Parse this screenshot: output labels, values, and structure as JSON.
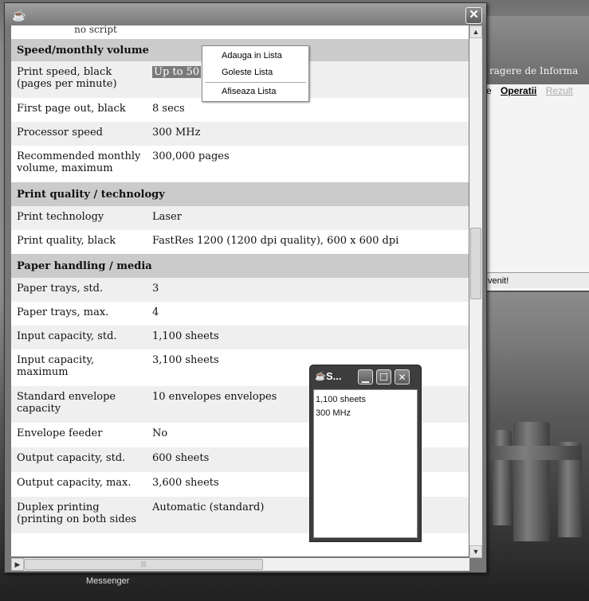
{
  "main_window": {
    "close_label": "✕",
    "noscript_text": "no script",
    "context_menu": {
      "items": [
        "Adauga in Lista",
        "Goleste Lista",
        "Afiseaza Lista"
      ]
    },
    "sections": [
      {
        "title": "Speed/monthly volume"
      },
      {
        "title": "Print quality / technology"
      },
      {
        "title": "Paper handling / media"
      }
    ],
    "rows": {
      "print_speed": {
        "label": "Print speed, black",
        "label2": "(pages per minute)",
        "value": "Up to 50"
      },
      "first_page": {
        "label": "First page out, black",
        "value": "8 secs"
      },
      "processor": {
        "label": "Processor speed",
        "value": "300 MHz"
      },
      "monthly": {
        "label": "Recommended monthly",
        "label2": "volume, maximum",
        "value": "300,000 pages"
      },
      "technology": {
        "label": "Print technology",
        "value": "Laser"
      },
      "quality": {
        "label": "Print quality, black",
        "value": "FastRes 1200 (1200 dpi quality), 600 x 600 dpi"
      },
      "trays_std": {
        "label": "Paper trays, std.",
        "value": "3"
      },
      "trays_max": {
        "label": "Paper trays, max.",
        "value": "4"
      },
      "input_std": {
        "label": "Input capacity, std.",
        "value": "1,100 sheets"
      },
      "input_max": {
        "label": "Input capacity,",
        "label2": "maximum",
        "value": "3,100 sheets"
      },
      "envelope_cap": {
        "label": "Standard envelope",
        "label2": "capacity",
        "value": "10 envelopes envelopes"
      },
      "envelope_feeder": {
        "label": "Envelope feeder",
        "value": "No"
      },
      "output_std": {
        "label": "Output capacity, std.",
        "value": "600 sheets"
      },
      "output_max": {
        "label": "Output capacity, max.",
        "value": "3,600 sheets"
      },
      "duplex": {
        "label": "Duplex printing",
        "label2": "(printing on both sides",
        "value": "Automatic (standard)"
      }
    }
  },
  "popup_window": {
    "title": "S...",
    "lines": [
      "1,100 sheets",
      "300 MHz"
    ]
  },
  "back_window": {
    "title": "ragere de Informa",
    "menu": [
      "e",
      "Operatii",
      "Rezult"
    ],
    "status": "venit!"
  },
  "desktop": {
    "label": "Messenger"
  },
  "icons": [
    "java-cup-icon",
    "close-icon",
    "minimize-icon",
    "maximize-icon",
    "scroll-up-icon",
    "scroll-down-icon",
    "scroll-left-icon",
    "scroll-right-icon"
  ]
}
